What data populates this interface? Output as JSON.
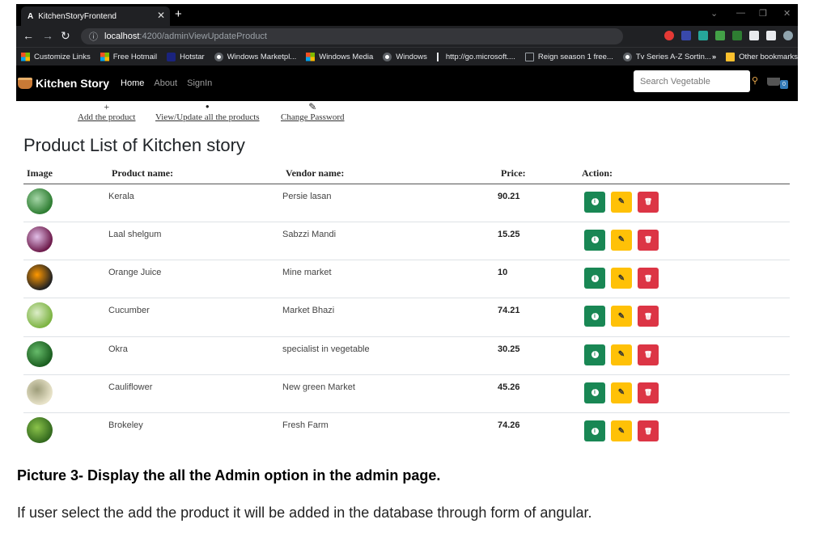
{
  "browser": {
    "tab_title": "KitchenStoryFrontend",
    "tab_favicon": "A",
    "url_host": "localhost",
    "url_path": ":4200/adminViewUpdateProduct",
    "bookmarks": [
      {
        "label": "Customize Links",
        "icon": "windows-icon"
      },
      {
        "label": "Free Hotmail",
        "icon": "windows-icon"
      },
      {
        "label": "Hotstar",
        "icon": "hotstar-icon"
      },
      {
        "label": "Windows Marketpl...",
        "icon": "globe-icon"
      },
      {
        "label": "Windows Media",
        "icon": "windows-icon"
      },
      {
        "label": "Windows",
        "icon": "globe-icon"
      },
      {
        "label": "http://go.microsoft....",
        "icon": "link-icon"
      },
      {
        "label": "Reign season 1 free...",
        "icon": "page-icon"
      },
      {
        "label": "Tv Series A-Z Sortin...",
        "icon": "globe-icon"
      }
    ],
    "other_bookmarks": "Other bookmarks"
  },
  "app": {
    "brand": "Kitchen Story",
    "nav": {
      "home": "Home",
      "about": "About",
      "signin": "SignIn"
    },
    "search_placeholder": "Search Vegetable",
    "cart_count": "0",
    "admin_links": [
      {
        "icon": "+",
        "label": "Add the product"
      },
      {
        "icon": "●",
        "label": "View/Update all the products"
      },
      {
        "icon": "✎",
        "label": "Change Password"
      }
    ],
    "page_title": "Product List of Kitchen story",
    "columns": {
      "image": "Image",
      "name": "Product name:",
      "vendor": "Vendor name:",
      "price": "Price:",
      "action": "Action:"
    },
    "products": [
      {
        "name": "Kerala",
        "vendor": "Persie lasan",
        "price": "90.21",
        "thumb_colors": [
          "#2e7d32",
          "#a5d6a7"
        ]
      },
      {
        "name": "Laal shelgum",
        "vendor": "Sabzzi Mandi",
        "price": "15.25",
        "thumb_colors": [
          "#6d1b4b",
          "#e1bee7"
        ]
      },
      {
        "name": "Orange Juice",
        "vendor": "Mine market",
        "price": "10",
        "thumb_colors": [
          "#222222",
          "#ff9800"
        ]
      },
      {
        "name": "Cucumber",
        "vendor": "Market Bhazi",
        "price": "74.21",
        "thumb_colors": [
          "#7cb342",
          "#dcedc8"
        ]
      },
      {
        "name": "Okra",
        "vendor": "specialist in vegetable",
        "price": "30.25",
        "thumb_colors": [
          "#1b5e20",
          "#66bb6a"
        ]
      },
      {
        "name": "Cauliflower",
        "vendor": "New green Market",
        "price": "45.26",
        "thumb_colors": [
          "#e8e3c9",
          "#9e9d7a"
        ]
      },
      {
        "name": "Brokeley",
        "vendor": "Fresh Farm",
        "price": "74.26",
        "thumb_colors": [
          "#33691e",
          "#8bc34a"
        ]
      }
    ],
    "action_icons": {
      "info": "i",
      "edit": "✎",
      "delete": "🗑"
    }
  },
  "document": {
    "caption": "Picture 3- Display the all the Admin option in the admin page.",
    "description": "If user select the add the product it will be added in the database through form of angular."
  }
}
